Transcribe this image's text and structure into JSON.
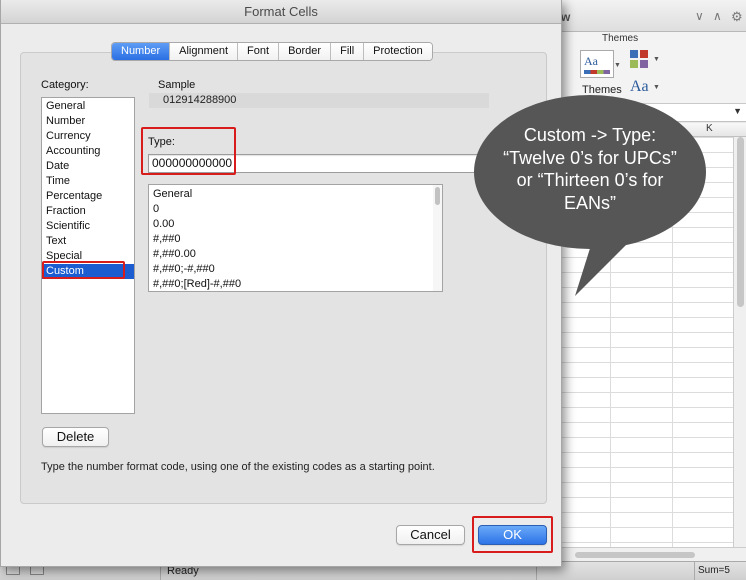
{
  "excel": {
    "ribbon_tab_fragment": "w",
    "themes_group_label": "Themes",
    "themes_button_label": "Themes",
    "theme_preview_text": "Aa",
    "fonts_preview_text": "Aa",
    "column_header": "K",
    "status_ready": "Ready",
    "status_sum": "Sum=5"
  },
  "dialog": {
    "title": "Format Cells",
    "tabs": [
      {
        "label": "Number",
        "active": true
      },
      {
        "label": "Alignment",
        "active": false
      },
      {
        "label": "Font",
        "active": false
      },
      {
        "label": "Border",
        "active": false
      },
      {
        "label": "Fill",
        "active": false
      },
      {
        "label": "Protection",
        "active": false
      }
    ],
    "category_label": "Category:",
    "categories": [
      "General",
      "Number",
      "Currency",
      "Accounting",
      "Date",
      "Time",
      "Percentage",
      "Fraction",
      "Scientific",
      "Text",
      "Special",
      "Custom"
    ],
    "selected_category": "Custom",
    "sample_label": "Sample",
    "sample_value": "012914288900",
    "type_label": "Type:",
    "type_value": "000000000000",
    "format_codes": [
      "General",
      "0",
      "0.00",
      "#,##0",
      "#,##0.00",
      "#,##0;-#,##0",
      "#,##0;[Red]-#,##0"
    ],
    "delete_label": "Delete",
    "hint": "Type the number format code, using one of the existing codes as a starting point.",
    "cancel_label": "Cancel",
    "ok_label": "OK"
  },
  "callout": {
    "lines": [
      "Custom -> Type:",
      "“Twelve 0’s for UPCs”",
      "or “Thirteen 0’s for",
      "EANs”"
    ],
    "fill_color": "#565656"
  },
  "annotation_color": "#d81b1b",
  "accent_color": "#2c73e8"
}
